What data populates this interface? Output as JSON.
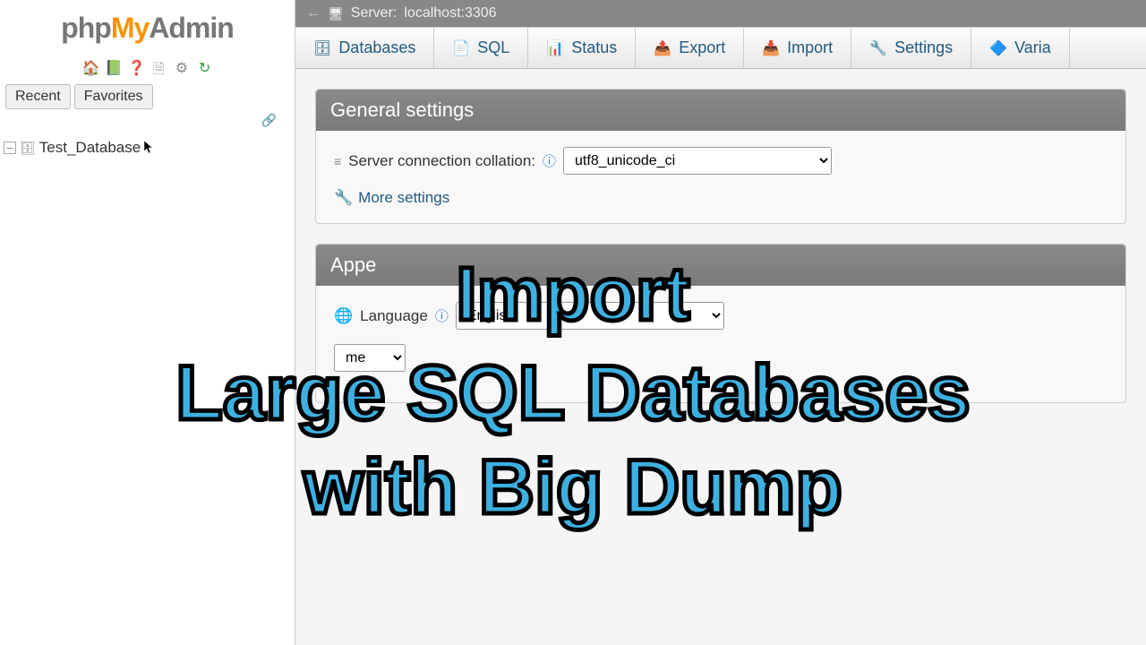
{
  "logo": {
    "php": "php",
    "my": "My",
    "admin": "Admin"
  },
  "sidebar": {
    "tabs": {
      "recent": "Recent",
      "favorites": "Favorites"
    },
    "tree": {
      "db_name": "Test_Database"
    }
  },
  "breadcrumb": {
    "server_label": "Server:",
    "server_value": "localhost:3306"
  },
  "tabs": {
    "databases": "Databases",
    "sql": "SQL",
    "status": "Status",
    "export": "Export",
    "import": "Import",
    "settings": "Settings",
    "variables": "Varia"
  },
  "panels": {
    "general": {
      "title": "General settings",
      "collation_label": "Server connection collation:",
      "collation_value": "utf8_unicode_ci",
      "more": "More settings"
    },
    "appearance": {
      "title": "Appe",
      "language_label": "Language",
      "language_value": "English",
      "theme_suffix": "me"
    }
  },
  "overlay": {
    "line1": "Import",
    "line2": "Large SQL Databases",
    "line3": "with Big Dump"
  }
}
